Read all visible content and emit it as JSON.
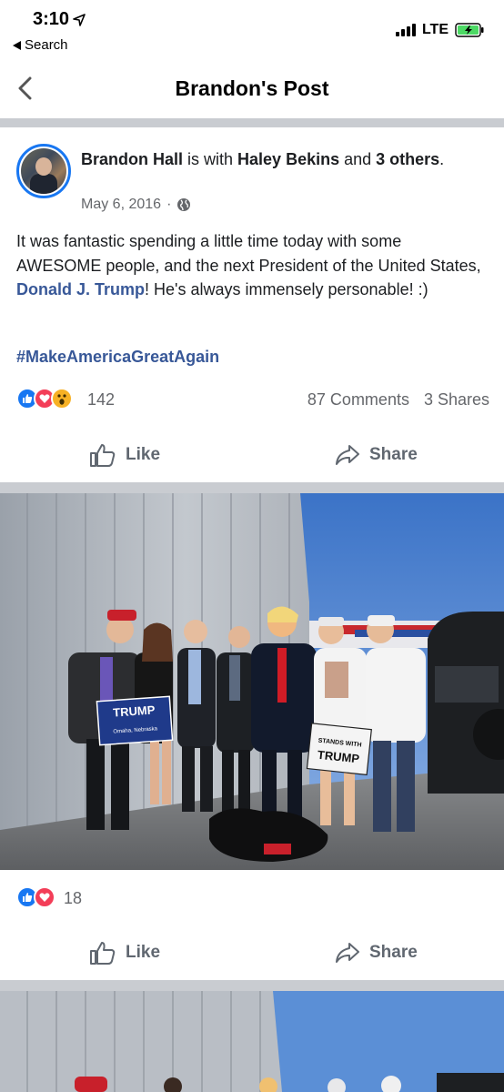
{
  "status_bar": {
    "time": "3:10",
    "back_to_app": "Search",
    "network": "LTE"
  },
  "nav": {
    "title": "Brandon's Post"
  },
  "post": {
    "author": "Brandon Hall",
    "with_text": " is with ",
    "tagged": "Haley Bekins",
    "and_text": " and ",
    "others": "3 others",
    "period": ".",
    "date": "May 6, 2016",
    "separator": "·",
    "privacy_icon": "globe-icon",
    "text_part1": "It was fantastic spending a little time today with some AWESOME people, and the next President of the United States, ",
    "mention": "Donald J. Trump",
    "text_part2": "! He's always immensely personable! :)",
    "hashtag": "#MakeAmericaGreatAgain",
    "reaction_count": "142",
    "comments": "87 Comments",
    "shares": "3 Shares",
    "like_label": "Like",
    "share_label": "Share"
  },
  "photos": [
    {
      "sign_trump": "TRUMP",
      "sign_city": "Omaha, Nebraska",
      "sign2_top": "STANDS WITH",
      "sign2_bottom": "TRUMP",
      "reaction_count": "18",
      "like_label": "Like",
      "share_label": "Share"
    }
  ],
  "colors": {
    "link": "#385898",
    "facebook_blue": "#1877f2",
    "love_red": "#f33e58",
    "divider": "#c9ccd1",
    "meta_gray": "#65676b"
  }
}
